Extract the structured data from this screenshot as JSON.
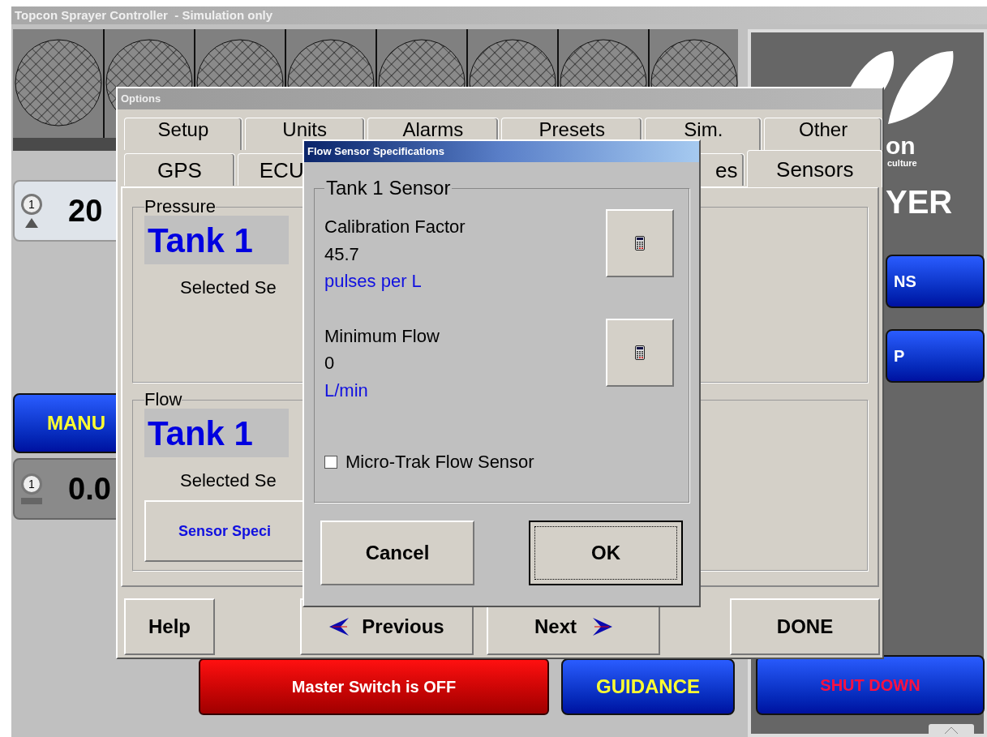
{
  "window": {
    "title": "Topcon Sprayer Controller  - Simulation only"
  },
  "gauges": [
    {
      "number": "1",
      "reading": "20",
      "kind": "rate"
    },
    {
      "number": "1",
      "reading": "0.0",
      "kind": "tank"
    }
  ],
  "mode_button": "MANU",
  "logo": {
    "name": "on",
    "tagline": "culture",
    "product": "YER"
  },
  "side_buttons": [
    "NS",
    "P"
  ],
  "bottom_bar": {
    "master_switch": "Master Switch is OFF",
    "guidance": "GUIDANCE",
    "shut_down": "SHUT DOWN"
  },
  "options": {
    "title": "Options",
    "tab_rows": [
      [
        {
          "label": "Setup",
          "selected": false
        },
        {
          "label": "Units",
          "selected": false
        },
        {
          "label": "Alarms",
          "selected": false
        },
        {
          "label": "Presets",
          "selected": false
        },
        {
          "label": "Sim.",
          "selected": false
        },
        {
          "label": "Other",
          "selected": false
        }
      ],
      [
        {
          "label": "GPS",
          "selected": false
        },
        {
          "label": "ECU",
          "selected": false
        },
        {
          "label": "es",
          "selected": false
        },
        {
          "label": "Sensors",
          "selected": true
        }
      ]
    ],
    "pressure": {
      "legend": "Pressure",
      "tank": "Tank 1",
      "selected_label": "Selected Se"
    },
    "flow": {
      "legend": "Flow",
      "tank": "Tank 1",
      "selected_label": "Selected Se",
      "spec_button": "Sensor Speci"
    },
    "buttons": {
      "help": "Help",
      "previous": "Previous",
      "next": "Next",
      "done": "DONE"
    }
  },
  "flow_dialog": {
    "title": "Flow Sensor Specifications",
    "group": "Tank 1 Sensor",
    "fields": [
      {
        "label": "Calibration Factor",
        "value": "45.7",
        "unit": "pulses per L"
      },
      {
        "label": "Minimum Flow",
        "value": "0",
        "unit": "L/min"
      }
    ],
    "checkbox": {
      "label": "Micro-Trak Flow Sensor",
      "checked": false
    },
    "buttons": [
      {
        "label": "Cancel",
        "default": false
      },
      {
        "label": "OK",
        "default": true
      }
    ]
  }
}
